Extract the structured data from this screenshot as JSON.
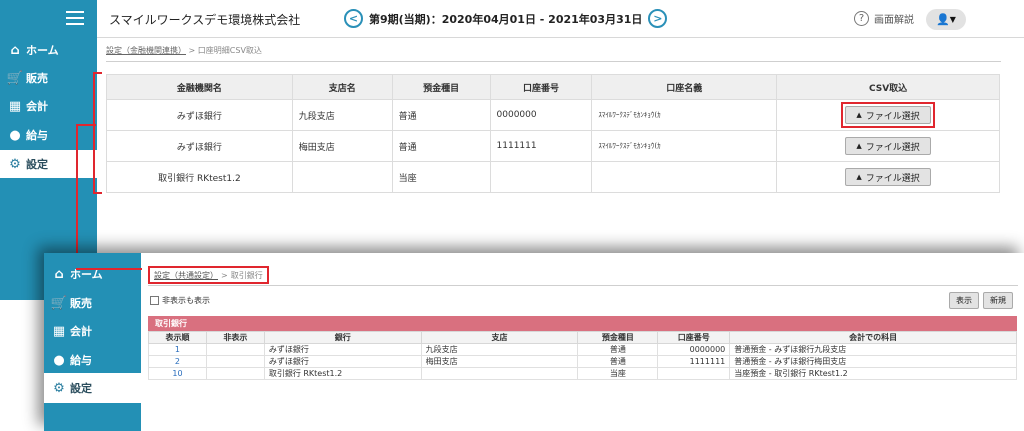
{
  "header": {
    "company": "スマイルワークスデモ環境株式会社",
    "period": "第9期(当期)：2020年04月01日 - 2021年03月31日",
    "help_label": "画面解説"
  },
  "sidebar": {
    "items": [
      {
        "label": "ホーム"
      },
      {
        "label": "販売"
      },
      {
        "label": "会計"
      },
      {
        "label": "給与"
      },
      {
        "label": "設定"
      }
    ]
  },
  "breadcrumb_main": {
    "link": "設定（金融機関連携）",
    "sep": ">",
    "current": "口座明細CSV取込"
  },
  "bank_table": {
    "headers": [
      "金融機関名",
      "支店名",
      "預金種目",
      "口座番号",
      "口座名義",
      "CSV取込"
    ],
    "file_button_label": "ファイル選択",
    "rows": [
      {
        "bank": "みずほ銀行",
        "branch": "九段支店",
        "type": "普通",
        "number": "0000000",
        "holder": "ｽﾏｲﾙﾜｰｸｽﾃﾞﾓｶﾝｷｮｳ(ｶ"
      },
      {
        "bank": "みずほ銀行",
        "branch": "梅田支店",
        "type": "普通",
        "number": "1111111",
        "holder": "ｽﾏｲﾙﾜｰｸｽﾃﾞﾓｶﾝｷｮｳ(ｶ"
      },
      {
        "bank": "取引銀行 RKtest1.2",
        "branch": "",
        "type": "当座",
        "number": "",
        "holder": ""
      }
    ]
  },
  "overlay": {
    "breadcrumb": {
      "link": "設定（共通設定）",
      "sep": ">",
      "current": "取引銀行"
    },
    "show_hidden_label": "非表示も表示",
    "display_button": "表示",
    "new_button": "新規",
    "section_title": "取引銀行",
    "table": {
      "headers": [
        "表示順",
        "非表示",
        "銀行",
        "支店",
        "預金種目",
        "口座番号",
        "会計での科目"
      ],
      "rows": [
        {
          "order": "1",
          "hidden": "",
          "bank": "みずほ銀行",
          "branch": "九段支店",
          "type": "普通",
          "number": "0000000",
          "account": "普通預金 - みずほ銀行九段支店"
        },
        {
          "order": "2",
          "hidden": "",
          "bank": "みずほ銀行",
          "branch": "梅田支店",
          "type": "普通",
          "number": "1111111",
          "account": "普通預金 - みずほ銀行梅田支店"
        },
        {
          "order": "10",
          "hidden": "",
          "bank": "取引銀行 RKtest1.2",
          "branch": "",
          "type": "当座",
          "number": "",
          "account": "当座預金 - 取引銀行 RKtest1.2"
        }
      ]
    }
  }
}
